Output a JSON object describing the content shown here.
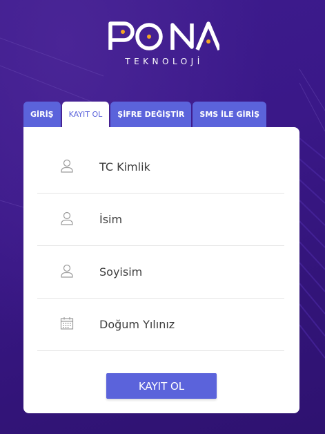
{
  "brand": {
    "logo_text": "PONA",
    "subtitle": "TEKNOLOJİ",
    "accent_color": "#f5a623"
  },
  "tabs": [
    {
      "label": "GİRİŞ",
      "active": false
    },
    {
      "label": "KAYIT OL",
      "active": true
    },
    {
      "label": "ŞİFRE DEĞİŞTİR",
      "active": false
    },
    {
      "label": "SMS İLE GİRİŞ",
      "active": false
    }
  ],
  "form": {
    "fields": [
      {
        "label": "TC Kimlik",
        "icon": "user-icon"
      },
      {
        "label": "İsim",
        "icon": "user-icon"
      },
      {
        "label": "Soyisim",
        "icon": "user-icon"
      },
      {
        "label": "Doğum Yılınız",
        "icon": "calendar-icon"
      }
    ],
    "submit_label": "KAYIT OL"
  },
  "colors": {
    "background": "#3a1a8a",
    "primary": "#5b63db",
    "card": "#ffffff"
  }
}
